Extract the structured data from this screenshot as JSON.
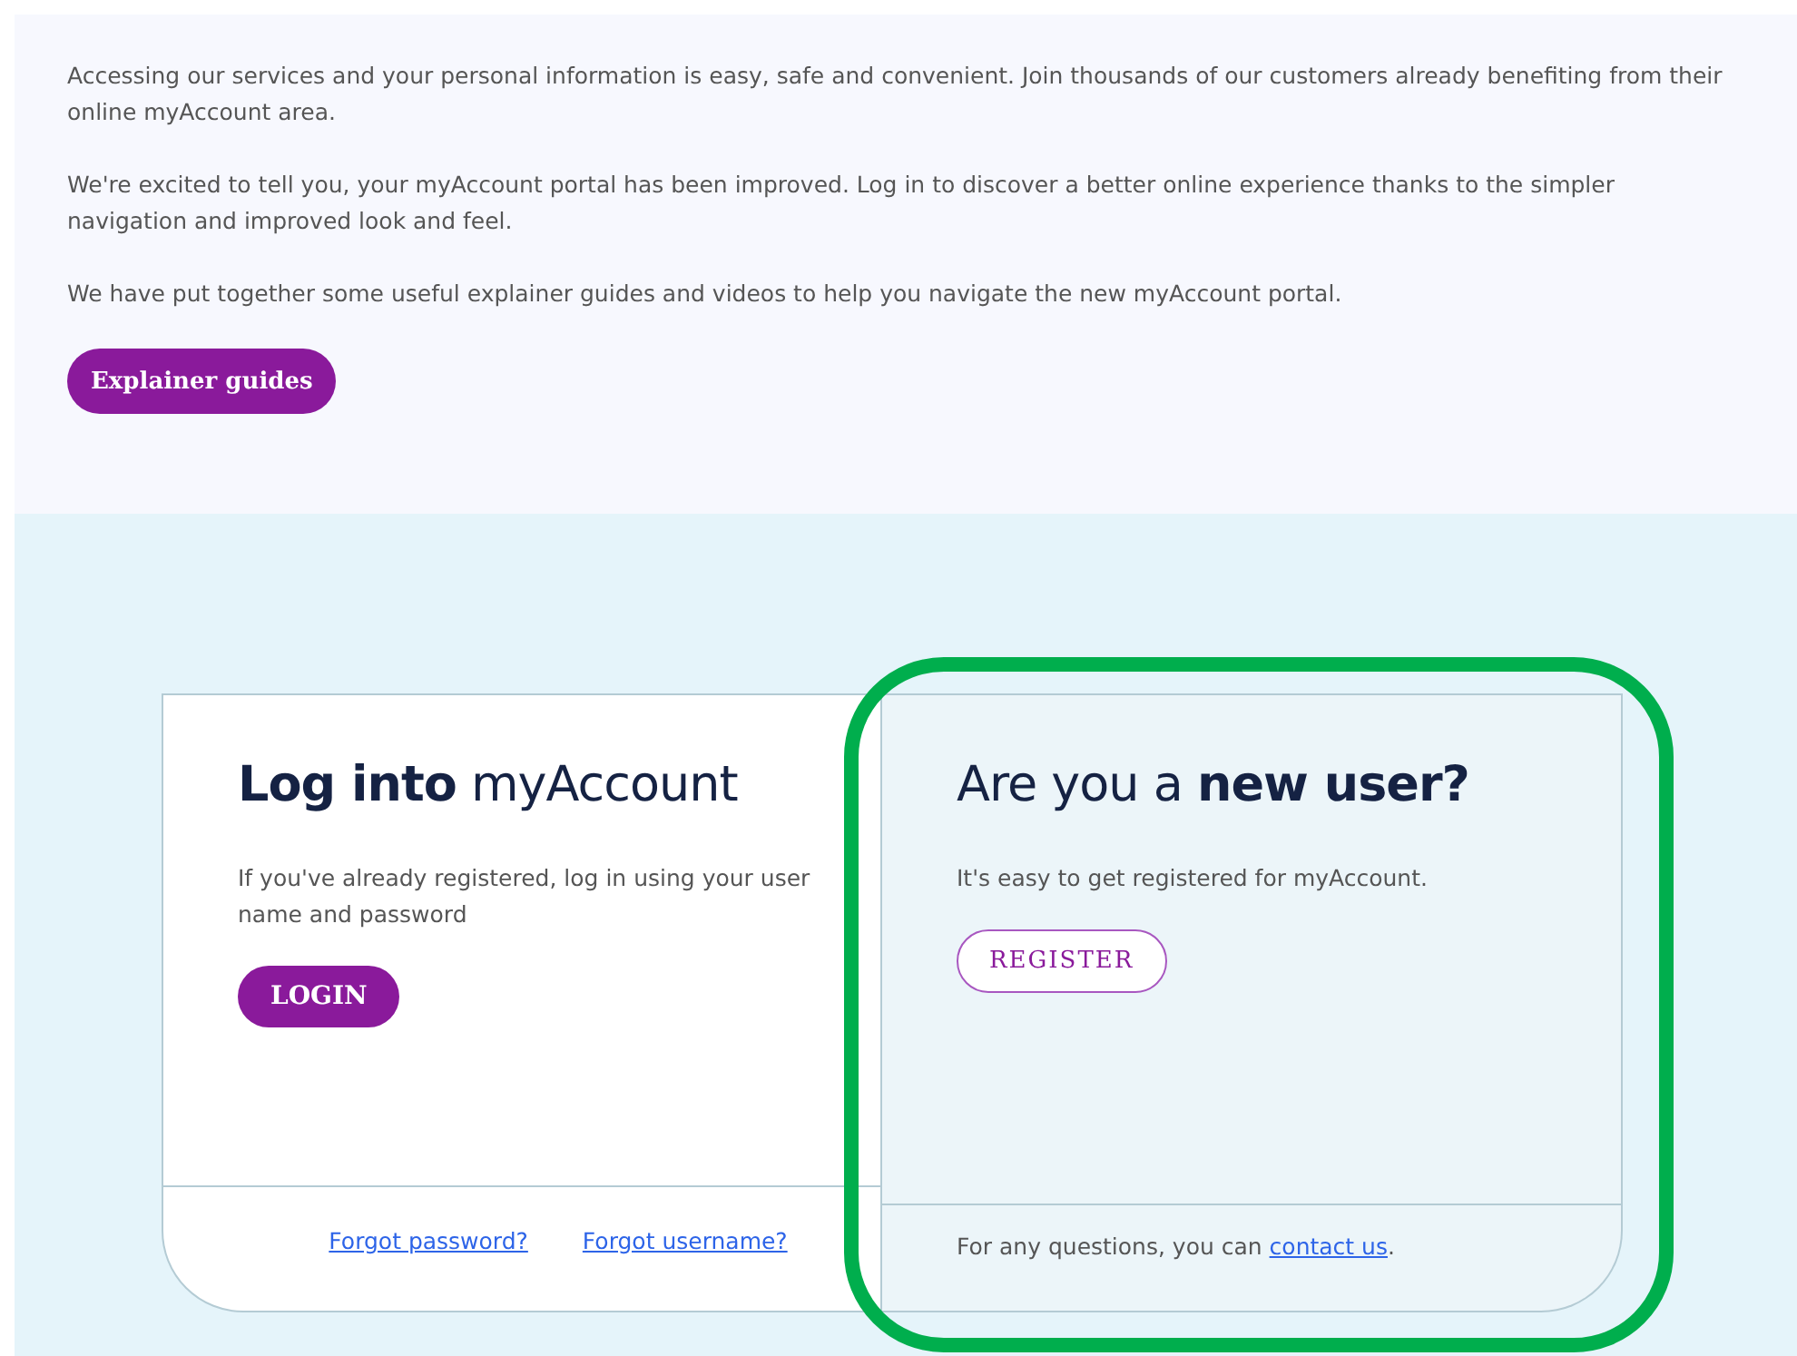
{
  "intro": {
    "paragraphs": [
      "Accessing our services and your personal information is easy, safe and convenient. Join thousands of our customers already benefiting from their online myAccount area.",
      "We're excited to tell you, your myAccount portal has been improved. Log in to discover a better online experience thanks to the simpler navigation and improved look and feel.",
      "We have put together some useful explainer guides and videos to help you navigate the new myAccount portal."
    ],
    "button": "Explainer guides"
  },
  "login_card": {
    "title": "**Log into** myAccount",
    "text": "If you've already registered, log in using your user name and password",
    "button": "LOGIN",
    "links": [
      "Forgot password?",
      "Forgot username?"
    ]
  },
  "register_card": {
    "title": "Are you a **new user?**",
    "text": "It's easy to get registered for myAccount.",
    "button": "REGISTER",
    "footer_text": "For any questions, you can ",
    "footer_link": "contact us",
    "footer_end": ".",
    "highlighted": true
  }
}
